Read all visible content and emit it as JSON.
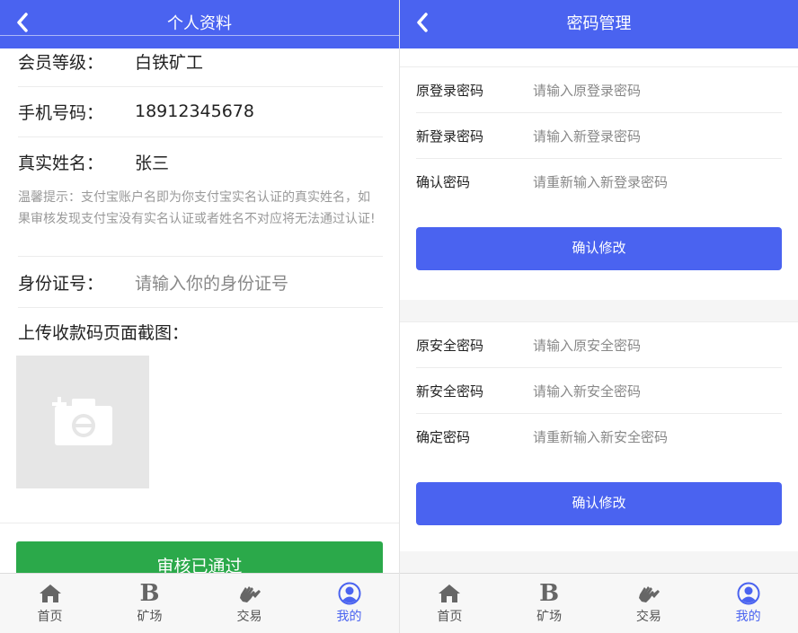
{
  "colors": {
    "primary": "#4a63f0",
    "success": "#2ba94a",
    "placeholder": "#888888",
    "tip": "#999999"
  },
  "left": {
    "header": {
      "title": "个人资料",
      "back_icon": "chevron-left-icon"
    },
    "rows": [
      {
        "label": "会员等级：",
        "value": "白铁矿工"
      },
      {
        "label": "手机号码：",
        "value": "18912345678"
      },
      {
        "label": "真实姓名：",
        "value": "张三"
      }
    ],
    "tip": "温馨提示：支付宝账户名即为你支付宝实名认证的真实姓名，如果审核发现支付宝没有实名认证或者姓名不对应将无法通过认证!",
    "id_row": {
      "label": "身份证号：",
      "placeholder": "请输入你的身份证号"
    },
    "upload_label": "上传收款码页面截图：",
    "upload_icon": "camera-add-icon",
    "status_button": "审核已通过"
  },
  "right": {
    "header": {
      "title": "密码管理",
      "back_icon": "chevron-left-icon"
    },
    "login_section": [
      {
        "label": "原登录密码",
        "placeholder": "请输入原登录密码"
      },
      {
        "label": "新登录密码",
        "placeholder": "请输入新登录密码"
      },
      {
        "label": "确认密码",
        "placeholder": "请重新输入新登录密码"
      }
    ],
    "login_button": "确认修改",
    "security_section": [
      {
        "label": "原安全密码",
        "placeholder": "请输入原安全密码"
      },
      {
        "label": "新安全密码",
        "placeholder": "请输入新安全密码"
      },
      {
        "label": "确定密码",
        "placeholder": "请重新输入新安全密码"
      }
    ],
    "security_button": "确认修改"
  },
  "tabbar": {
    "items": [
      {
        "label": "首页",
        "icon": "home-icon",
        "glyph": ""
      },
      {
        "label": "矿场",
        "icon": "b-letter-icon",
        "glyph": "B"
      },
      {
        "label": "交易",
        "icon": "handshake-icon",
        "glyph": ""
      },
      {
        "label": "我的",
        "icon": "user-circle-icon",
        "glyph": "",
        "active": true
      }
    ]
  }
}
